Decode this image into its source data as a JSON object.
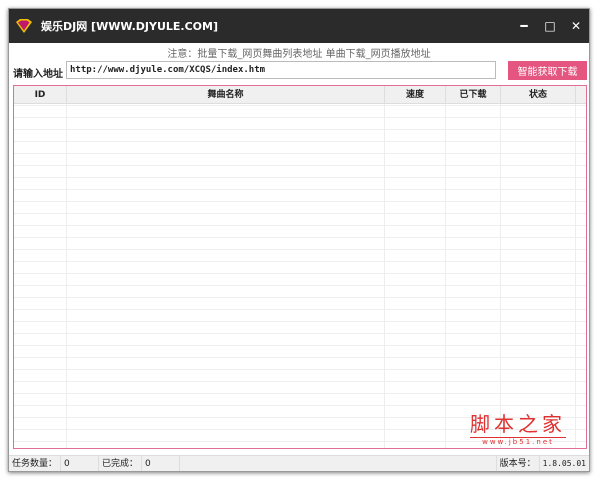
{
  "window": {
    "title": "娱乐DJ网 [WWW.DJYULE.COM]",
    "minimize": "━",
    "maximize": "□",
    "close": "✕",
    "logo_icon": "superman-logo"
  },
  "notice": "注意：批量下载_网页舞曲列表地址 单曲下载_网页播放地址",
  "url_label": "请输入地址",
  "url_value": "http://www.djyule.com/XCQS/index.htm",
  "fetch_button": "智能获取下载",
  "table": {
    "columns": [
      "ID",
      "舞曲名称",
      "速度",
      "已下载",
      "状态"
    ],
    "rows": []
  },
  "watermark": {
    "main": "脚本之家",
    "sub": "www.jb51.net"
  },
  "statusbar": {
    "task_label": "任务数量：",
    "task_value": "0",
    "done_label": "已完成：",
    "done_value": "0",
    "version_label": "版本号：",
    "version_value": "1.8.05.01"
  }
}
